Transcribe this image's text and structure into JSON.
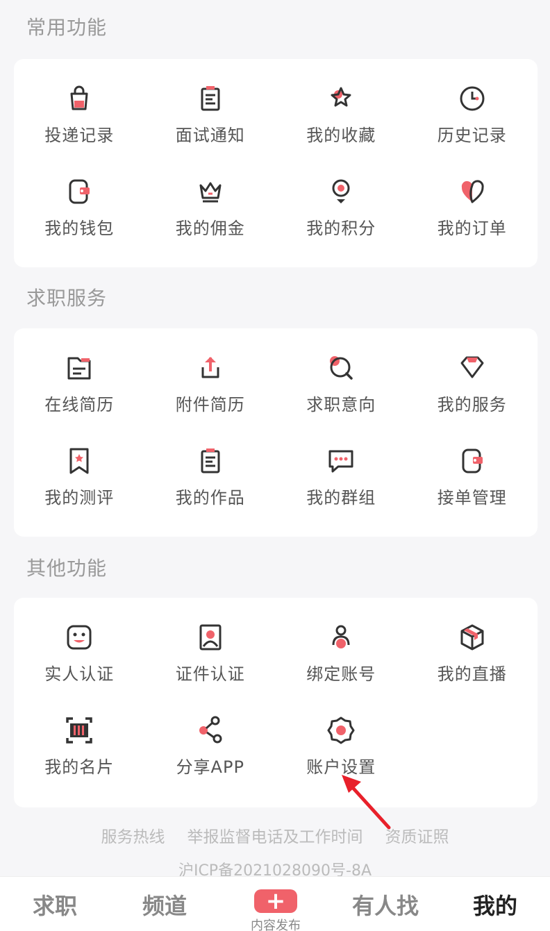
{
  "colors": {
    "accent": "#f0626a",
    "icon_stroke": "#333333",
    "arrow": "#e8202a"
  },
  "sections": [
    {
      "title": "常用功能",
      "items": [
        {
          "label": "投递记录",
          "icon": "bag-icon"
        },
        {
          "label": "面试通知",
          "icon": "document-icon"
        },
        {
          "label": "我的收藏",
          "icon": "star-icon"
        },
        {
          "label": "历史记录",
          "icon": "clock-icon"
        },
        {
          "label": "我的钱包",
          "icon": "wallet-icon"
        },
        {
          "label": "我的佣金",
          "icon": "crown-icon"
        },
        {
          "label": "我的积分",
          "icon": "location-pin-icon"
        },
        {
          "label": "我的订单",
          "icon": "heart-icon"
        }
      ]
    },
    {
      "title": "求职服务",
      "items": [
        {
          "label": "在线简历",
          "icon": "folder-icon"
        },
        {
          "label": "附件简历",
          "icon": "upload-icon"
        },
        {
          "label": "求职意向",
          "icon": "search-icon"
        },
        {
          "label": "我的服务",
          "icon": "diamond-icon"
        },
        {
          "label": "我的测评",
          "icon": "bookmark-star-icon"
        },
        {
          "label": "我的作品",
          "icon": "document-icon"
        },
        {
          "label": "我的群组",
          "icon": "chat-icon"
        },
        {
          "label": "接单管理",
          "icon": "wallet-icon"
        }
      ]
    },
    {
      "title": "其他功能",
      "items": [
        {
          "label": "实人认证",
          "icon": "face-icon"
        },
        {
          "label": "证件认证",
          "icon": "id-photo-icon"
        },
        {
          "label": "绑定账号",
          "icon": "user-icon"
        },
        {
          "label": "我的直播",
          "icon": "cube-icon"
        },
        {
          "label": "我的名片",
          "icon": "barcode-icon"
        },
        {
          "label": "分享APP",
          "icon": "share-icon"
        },
        {
          "label": "账户设置",
          "icon": "settings-icon"
        }
      ]
    }
  ],
  "footer": {
    "links": [
      "服务热线",
      "举报监督电话及工作时间",
      "资质证照"
    ],
    "icp": "沪ICP备2021028090号-8A"
  },
  "tabbar": {
    "tabs": [
      "求职",
      "频道",
      "有人找",
      "我的"
    ],
    "publish_symbol": "+",
    "publish_label": "内容发布",
    "active": "我的"
  }
}
